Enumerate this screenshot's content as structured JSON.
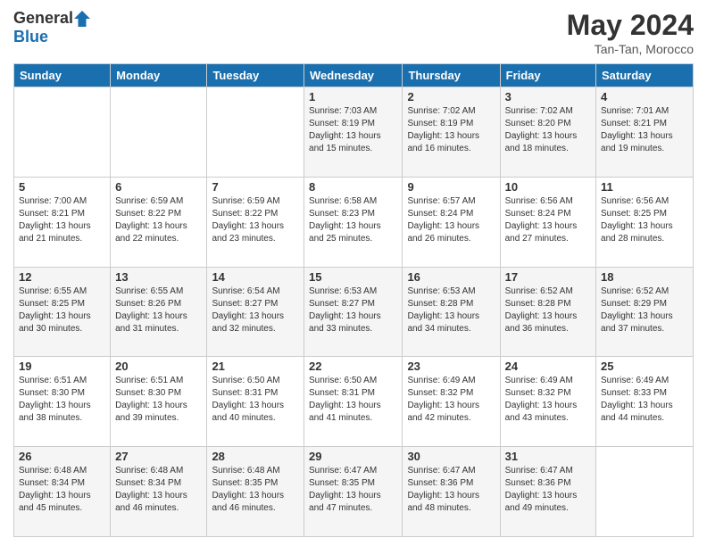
{
  "header": {
    "logo_general": "General",
    "logo_blue": "Blue",
    "month_title": "May 2024",
    "subtitle": "Tan-Tan, Morocco"
  },
  "days_of_week": [
    "Sunday",
    "Monday",
    "Tuesday",
    "Wednesday",
    "Thursday",
    "Friday",
    "Saturday"
  ],
  "weeks": [
    [
      {
        "day": "",
        "sunrise": "",
        "sunset": "",
        "daylight": ""
      },
      {
        "day": "",
        "sunrise": "",
        "sunset": "",
        "daylight": ""
      },
      {
        "day": "",
        "sunrise": "",
        "sunset": "",
        "daylight": ""
      },
      {
        "day": "1",
        "sunrise": "Sunrise: 7:03 AM",
        "sunset": "Sunset: 8:19 PM",
        "daylight": "Daylight: 13 hours and 15 minutes."
      },
      {
        "day": "2",
        "sunrise": "Sunrise: 7:02 AM",
        "sunset": "Sunset: 8:19 PM",
        "daylight": "Daylight: 13 hours and 16 minutes."
      },
      {
        "day": "3",
        "sunrise": "Sunrise: 7:02 AM",
        "sunset": "Sunset: 8:20 PM",
        "daylight": "Daylight: 13 hours and 18 minutes."
      },
      {
        "day": "4",
        "sunrise": "Sunrise: 7:01 AM",
        "sunset": "Sunset: 8:21 PM",
        "daylight": "Daylight: 13 hours and 19 minutes."
      }
    ],
    [
      {
        "day": "5",
        "sunrise": "Sunrise: 7:00 AM",
        "sunset": "Sunset: 8:21 PM",
        "daylight": "Daylight: 13 hours and 21 minutes."
      },
      {
        "day": "6",
        "sunrise": "Sunrise: 6:59 AM",
        "sunset": "Sunset: 8:22 PM",
        "daylight": "Daylight: 13 hours and 22 minutes."
      },
      {
        "day": "7",
        "sunrise": "Sunrise: 6:59 AM",
        "sunset": "Sunset: 8:22 PM",
        "daylight": "Daylight: 13 hours and 23 minutes."
      },
      {
        "day": "8",
        "sunrise": "Sunrise: 6:58 AM",
        "sunset": "Sunset: 8:23 PM",
        "daylight": "Daylight: 13 hours and 25 minutes."
      },
      {
        "day": "9",
        "sunrise": "Sunrise: 6:57 AM",
        "sunset": "Sunset: 8:24 PM",
        "daylight": "Daylight: 13 hours and 26 minutes."
      },
      {
        "day": "10",
        "sunrise": "Sunrise: 6:56 AM",
        "sunset": "Sunset: 8:24 PM",
        "daylight": "Daylight: 13 hours and 27 minutes."
      },
      {
        "day": "11",
        "sunrise": "Sunrise: 6:56 AM",
        "sunset": "Sunset: 8:25 PM",
        "daylight": "Daylight: 13 hours and 28 minutes."
      }
    ],
    [
      {
        "day": "12",
        "sunrise": "Sunrise: 6:55 AM",
        "sunset": "Sunset: 8:25 PM",
        "daylight": "Daylight: 13 hours and 30 minutes."
      },
      {
        "day": "13",
        "sunrise": "Sunrise: 6:55 AM",
        "sunset": "Sunset: 8:26 PM",
        "daylight": "Daylight: 13 hours and 31 minutes."
      },
      {
        "day": "14",
        "sunrise": "Sunrise: 6:54 AM",
        "sunset": "Sunset: 8:27 PM",
        "daylight": "Daylight: 13 hours and 32 minutes."
      },
      {
        "day": "15",
        "sunrise": "Sunrise: 6:53 AM",
        "sunset": "Sunset: 8:27 PM",
        "daylight": "Daylight: 13 hours and 33 minutes."
      },
      {
        "day": "16",
        "sunrise": "Sunrise: 6:53 AM",
        "sunset": "Sunset: 8:28 PM",
        "daylight": "Daylight: 13 hours and 34 minutes."
      },
      {
        "day": "17",
        "sunrise": "Sunrise: 6:52 AM",
        "sunset": "Sunset: 8:28 PM",
        "daylight": "Daylight: 13 hours and 36 minutes."
      },
      {
        "day": "18",
        "sunrise": "Sunrise: 6:52 AM",
        "sunset": "Sunset: 8:29 PM",
        "daylight": "Daylight: 13 hours and 37 minutes."
      }
    ],
    [
      {
        "day": "19",
        "sunrise": "Sunrise: 6:51 AM",
        "sunset": "Sunset: 8:30 PM",
        "daylight": "Daylight: 13 hours and 38 minutes."
      },
      {
        "day": "20",
        "sunrise": "Sunrise: 6:51 AM",
        "sunset": "Sunset: 8:30 PM",
        "daylight": "Daylight: 13 hours and 39 minutes."
      },
      {
        "day": "21",
        "sunrise": "Sunrise: 6:50 AM",
        "sunset": "Sunset: 8:31 PM",
        "daylight": "Daylight: 13 hours and 40 minutes."
      },
      {
        "day": "22",
        "sunrise": "Sunrise: 6:50 AM",
        "sunset": "Sunset: 8:31 PM",
        "daylight": "Daylight: 13 hours and 41 minutes."
      },
      {
        "day": "23",
        "sunrise": "Sunrise: 6:49 AM",
        "sunset": "Sunset: 8:32 PM",
        "daylight": "Daylight: 13 hours and 42 minutes."
      },
      {
        "day": "24",
        "sunrise": "Sunrise: 6:49 AM",
        "sunset": "Sunset: 8:32 PM",
        "daylight": "Daylight: 13 hours and 43 minutes."
      },
      {
        "day": "25",
        "sunrise": "Sunrise: 6:49 AM",
        "sunset": "Sunset: 8:33 PM",
        "daylight": "Daylight: 13 hours and 44 minutes."
      }
    ],
    [
      {
        "day": "26",
        "sunrise": "Sunrise: 6:48 AM",
        "sunset": "Sunset: 8:34 PM",
        "daylight": "Daylight: 13 hours and 45 minutes."
      },
      {
        "day": "27",
        "sunrise": "Sunrise: 6:48 AM",
        "sunset": "Sunset: 8:34 PM",
        "daylight": "Daylight: 13 hours and 46 minutes."
      },
      {
        "day": "28",
        "sunrise": "Sunrise: 6:48 AM",
        "sunset": "Sunset: 8:35 PM",
        "daylight": "Daylight: 13 hours and 46 minutes."
      },
      {
        "day": "29",
        "sunrise": "Sunrise: 6:47 AM",
        "sunset": "Sunset: 8:35 PM",
        "daylight": "Daylight: 13 hours and 47 minutes."
      },
      {
        "day": "30",
        "sunrise": "Sunrise: 6:47 AM",
        "sunset": "Sunset: 8:36 PM",
        "daylight": "Daylight: 13 hours and 48 minutes."
      },
      {
        "day": "31",
        "sunrise": "Sunrise: 6:47 AM",
        "sunset": "Sunset: 8:36 PM",
        "daylight": "Daylight: 13 hours and 49 minutes."
      },
      {
        "day": "",
        "sunrise": "",
        "sunset": "",
        "daylight": ""
      }
    ]
  ]
}
